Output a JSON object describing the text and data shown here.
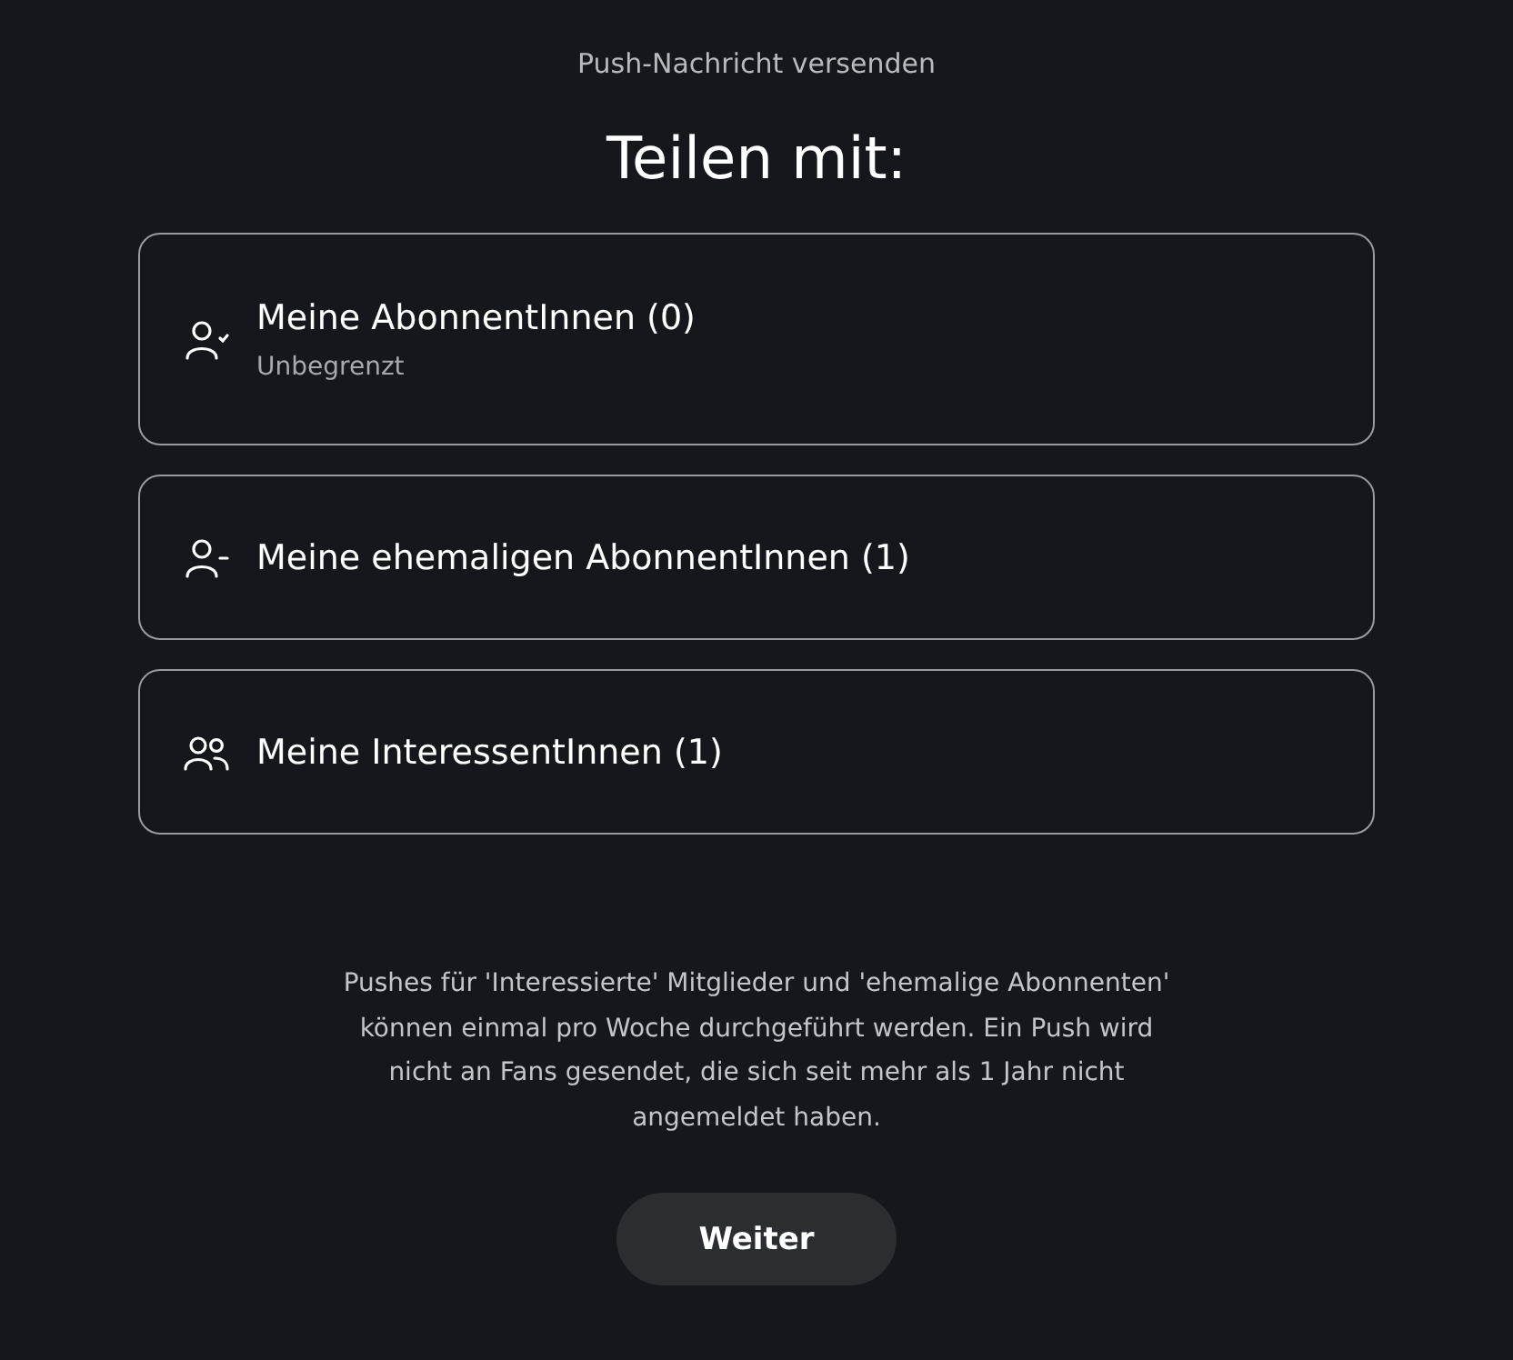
{
  "header": {
    "subtitle": "Push-Nachricht versenden",
    "title": "Teilen mit:"
  },
  "options": [
    {
      "kind": "check",
      "label": "Meine AbonnentInnen (0)",
      "detail": "Unbegrenzt"
    },
    {
      "kind": "minus",
      "label": "Meine ehemaligen AbonnentInnen (1)"
    },
    {
      "kind": "group",
      "label": "Meine InteressentInnen (1)"
    }
  ],
  "note": "Pushes für 'Interessierte' Mitglieder und 'ehemalige Abonnenten' können einmal pro Woche durchgeführt werden. Ein Push wird nicht an Fans gesendet, die sich seit mehr als 1 Jahr nicht angemeldet haben.",
  "button": "Weiter"
}
